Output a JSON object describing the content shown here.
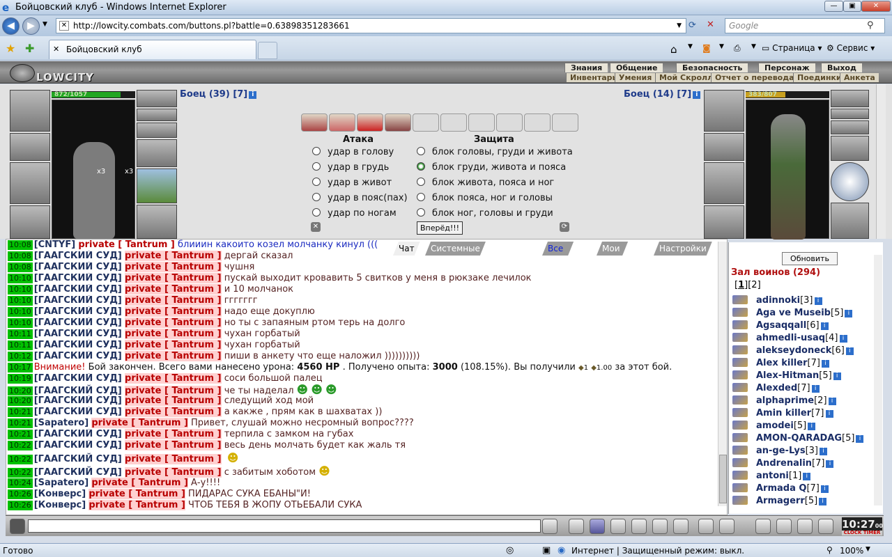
{
  "window": {
    "title": "Бойцовский клуб - Windows Internet Explorer"
  },
  "browser": {
    "url": "http://lowcity.combats.com/buttons.pl?battle=0.63898351283661",
    "search_placeholder": "Google",
    "tab_title": "Бойцовский клуб",
    "page_menu": "Страница",
    "tools_menu": "Сервис",
    "status_left": "Готово",
    "status_zone": "Интернет | Защищенный режим: выкл.",
    "zoom": "100%"
  },
  "game": {
    "logo": "LOWCITY",
    "menu_top": [
      "Знания",
      "Общение",
      "Безопасность",
      "Персонаж",
      "Выход"
    ],
    "menu_bottom": [
      "Инвентарь",
      "Умения",
      "Мой Скролл",
      "Отчет о переводах",
      "Поединки",
      "Анкета"
    ],
    "fighter_left": {
      "name": "Боец (39) [7]",
      "hp": "872/1057",
      "hp_fraction": 0.825
    },
    "fighter_right": {
      "name": "Боец (14) [7]",
      "hp": "383/807",
      "hp_fraction": 0.475
    },
    "attack_header": "Атака",
    "defense_header": "Защита",
    "attacks": [
      "удар в голову",
      "удар в грудь",
      "удар в живот",
      "удар в пояс(пах)",
      "удар по ногам"
    ],
    "defenses": [
      "блок головы, груди и живота",
      "блок груди, живота и пояса",
      "блок живота, пояса и ног",
      "блок пояса, ног и головы",
      "блок ног, головы и груди"
    ],
    "go_button": "Вперёд!!!",
    "slot_counts": [
      "x3",
      "x3"
    ]
  },
  "chat": {
    "tabs": [
      "Чат",
      "Системные сообщения",
      "Все логи",
      "Мои логи",
      "Настройки"
    ],
    "lines": [
      {
        "time": "10:08",
        "nick": "[CNTYF]",
        "priv": "private [ Tantrum ]",
        "text": "блииин какоито козел молчанку кинул (((",
        "blue": true
      },
      {
        "time": "10:08",
        "nick": "[ГААГСКИЙ СУД]",
        "priv": "private [ Tantrum ]",
        "text": "дергай сказал"
      },
      {
        "time": "10:08",
        "nick": "[ГААГСКИЙ СУД]",
        "priv": "private [ Tantrum ]",
        "text": "чушня"
      },
      {
        "time": "10:10",
        "nick": "[ГААГСКИЙ СУД]",
        "priv": "private [ Tantrum ]",
        "text": "пускай выходит кровавить 5 свитков у меня в рюкзаке лечилок"
      },
      {
        "time": "10:10",
        "nick": "[ГААГСКИЙ СУД]",
        "priv": "private [ Tantrum ]",
        "text": "и 10 молчанок"
      },
      {
        "time": "10:10",
        "nick": "[ГААГСКИЙ СУД]",
        "priv": "private [ Tantrum ]",
        "text": "ггггггг"
      },
      {
        "time": "10:10",
        "nick": "[ГААГСКИЙ СУД]",
        "priv": "private [ Tantrum ]",
        "text": "надо еще докуплю"
      },
      {
        "time": "10:10",
        "nick": "[ГААГСКИЙ СУД]",
        "priv": "private [ Tantrum ]",
        "text": "но ты с запаяным ртом терь на долго"
      },
      {
        "time": "10:11",
        "nick": "[ГААГСКИЙ СУД]",
        "priv": "private [ Tantrum ]",
        "text": "чухан горбатый"
      },
      {
        "time": "10:11",
        "nick": "[ГААГСКИЙ СУД]",
        "priv": "private [ Tantrum ]",
        "text": "чухан горбатый"
      },
      {
        "time": "10:12",
        "nick": "[ГААГСКИЙ СУД]",
        "priv": "private [ Tantrum ]",
        "text": "пиши в анкету что еще наложил ))))))))))"
      },
      {
        "time": "10:17",
        "system": true,
        "warn": "Внимание!",
        "text1": "Бой закончен. Всего вами нанесено урона:",
        "dmg": "4560 HP",
        "text2": ". Получено опыта:",
        "exp": "3000",
        "text3": "(108.15%). Вы получили",
        "cur1": "1",
        "cur2": "1.00",
        "text4": "за этот бой."
      },
      {
        "time": "10:19",
        "nick": "[ГААГСКИЙ СУД]",
        "priv": "private [ Tantrum ]",
        "text": "соси большой палец"
      },
      {
        "time": "10:20",
        "nick": "[ГААГСКИЙ СУД]",
        "priv": "private [ Tantrum ]",
        "text": "че ты наделал",
        "smiles": 3
      },
      {
        "time": "10:20",
        "nick": "[ГААГСКИЙ СУД]",
        "priv": "private [ Tantrum ]",
        "text": "следущий ход мой"
      },
      {
        "time": "10:21",
        "nick": "[ГААГСКИЙ СУД]",
        "priv": "private [ Tantrum ]",
        "text": "а какже , прям как в шахватах ))"
      },
      {
        "time": "10:21",
        "nick": "[Sapatero]",
        "priv": "private [ Tantrum ]",
        "text": "Привет, слушай можно несромный вопрос????"
      },
      {
        "time": "10:21",
        "nick": "[ГААГСКИЙ СУД]",
        "priv": "private [ Tantrum ]",
        "text": "терпила с замком на губах"
      },
      {
        "time": "10:22",
        "nick": "[ГААГСКИЙ СУД]",
        "priv": "private [ Tantrum ]",
        "text": "весь день молчать будет как жаль тя"
      },
      {
        "time": "10:22",
        "nick": "[ГААГСКИЙ СУД]",
        "priv": "private [ Tantrum ]",
        "text": "",
        "smiles": 1,
        "tall": true
      },
      {
        "time": "10:22",
        "nick": "[ГААГСКИЙ СУД]",
        "priv": "private [ Tantrum ]",
        "text": "с забитым хоботом",
        "smiles": 1,
        "tall": true
      },
      {
        "time": "10:24",
        "nick": "[Sapatero]",
        "priv": "private [ Tantrum ]",
        "text": "А-у!!!!"
      },
      {
        "time": "10:26",
        "nick": "[Конверс]",
        "priv": "private [ Tantrum ]",
        "text": "ПИДАРАС СУКА ЁБАНЫ\"Й!"
      },
      {
        "time": "10:26",
        "nick": "[Конверс]",
        "priv": "private [ Tantrum ]",
        "text": "ЧТОБ ТЕБЯ В ЖОПУ ОТЬЕБАЛИ СУКА"
      }
    ]
  },
  "hall": {
    "refresh": "Обновить",
    "title": "Зал воинов (294)",
    "pages": [
      "1",
      "2"
    ],
    "users": [
      {
        "name": "adinnoki",
        "level": "[3]"
      },
      {
        "name": "Aga ve Museib",
        "level": "[5]"
      },
      {
        "name": "Agsaqqall",
        "level": "[6]"
      },
      {
        "name": "ahmedli-usaq",
        "level": "[4]"
      },
      {
        "name": "alekseydoneck",
        "level": "[6]"
      },
      {
        "name": "Alex killer",
        "level": "[7]"
      },
      {
        "name": "Alex-Hitman",
        "level": "[5]"
      },
      {
        "name": "Alexded",
        "level": "[7]"
      },
      {
        "name": "alphaprime",
        "level": "[2]"
      },
      {
        "name": "Amin killer",
        "level": "[7]"
      },
      {
        "name": "amodei",
        "level": "[5]"
      },
      {
        "name": "AMON-QARADAG",
        "level": "[5]"
      },
      {
        "name": "an-ge-Lys",
        "level": "[3]"
      },
      {
        "name": "Andrenalin",
        "level": "[7]"
      },
      {
        "name": "antoni",
        "level": "[1]"
      },
      {
        "name": "Armada Q",
        "level": "[7]"
      },
      {
        "name": "Armagerr",
        "level": "[5]"
      }
    ]
  },
  "toolbar": {
    "clock": "10:27",
    "clock_sec": "00",
    "clock_label": "CLOCK TIMER"
  },
  "colors": {
    "hp_green": "#22a622",
    "time_bg": "#00c000",
    "private_red": "#b80000",
    "nick_blue": "#20325f"
  }
}
